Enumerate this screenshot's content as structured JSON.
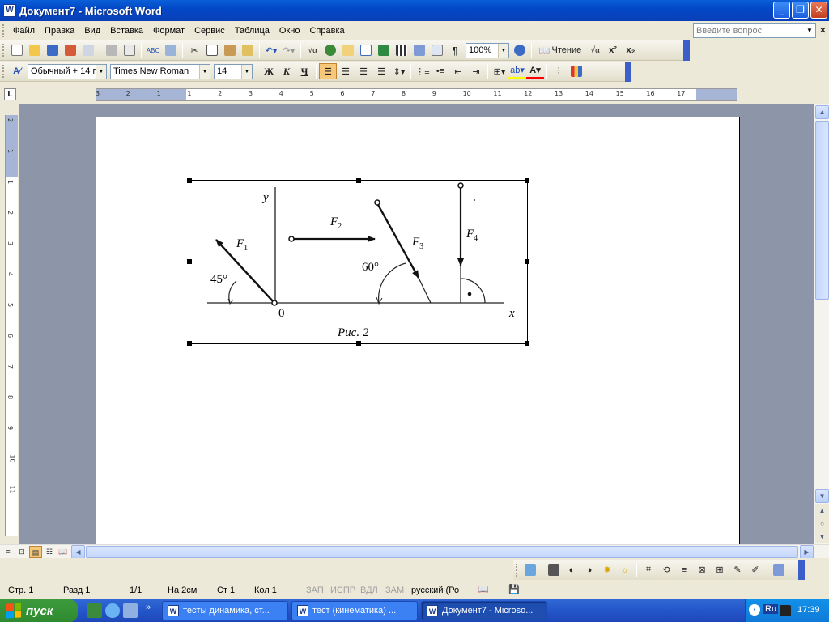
{
  "window": {
    "title": "Документ7 - Microsoft Word",
    "icon": "W"
  },
  "menu": {
    "items": [
      "Файл",
      "Правка",
      "Вид",
      "Вставка",
      "Формат",
      "Сервис",
      "Таблица",
      "Окно",
      "Справка"
    ],
    "ask_placeholder": "Введите вопрос"
  },
  "toolbar": {
    "zoom": "100%",
    "reading_label": "Чтение",
    "style": "Обычный + 14 г",
    "font": "Times New Roman",
    "size": "14",
    "bold": "Ж",
    "italic": "К",
    "underline": "Ч"
  },
  "ruler": {
    "h_numbers": [
      "3",
      "2",
      "1",
      "1",
      "2",
      "3",
      "4",
      "5",
      "6",
      "7",
      "8",
      "9",
      "10",
      "11",
      "12",
      "13",
      "14",
      "15",
      "16",
      "17"
    ],
    "v_numbers": [
      "2",
      "1",
      "1",
      "2",
      "3",
      "4",
      "5",
      "6",
      "7",
      "8",
      "9",
      "10",
      "11"
    ]
  },
  "figure": {
    "y_axis": "y",
    "x_axis": "x",
    "origin": "0",
    "f1": "F",
    "f1_sub": "1",
    "f2": "F",
    "f2_sub": "2",
    "f3": "F",
    "f3_sub": "3",
    "f4": "F",
    "f4_sub": "4",
    "angle1": "45°",
    "angle3": "60°",
    "caption": "Рис. 2"
  },
  "status": {
    "page": "Стр.  1",
    "section": "Разд  1",
    "pages": "1/1",
    "at": "На  2см",
    "line": "Ст  1",
    "col": "Кол  1",
    "rec": "ЗАП",
    "trk": "ИСПР",
    "ext": "ВДЛ",
    "ovr": "ЗАМ",
    "lang": "русский (Ро"
  },
  "taskbar": {
    "start": "пуск",
    "tasks": [
      "тесты динамика, ст...",
      "тест (кинематика) ...",
      "Документ7 - Microso..."
    ],
    "lang": "Ru",
    "time": "17:39"
  },
  "colors": {
    "titlebar": "#0348c6",
    "taskbar": "#2456c9",
    "start": "#3c9a3c",
    "doc_bg": "#8c96a8"
  }
}
